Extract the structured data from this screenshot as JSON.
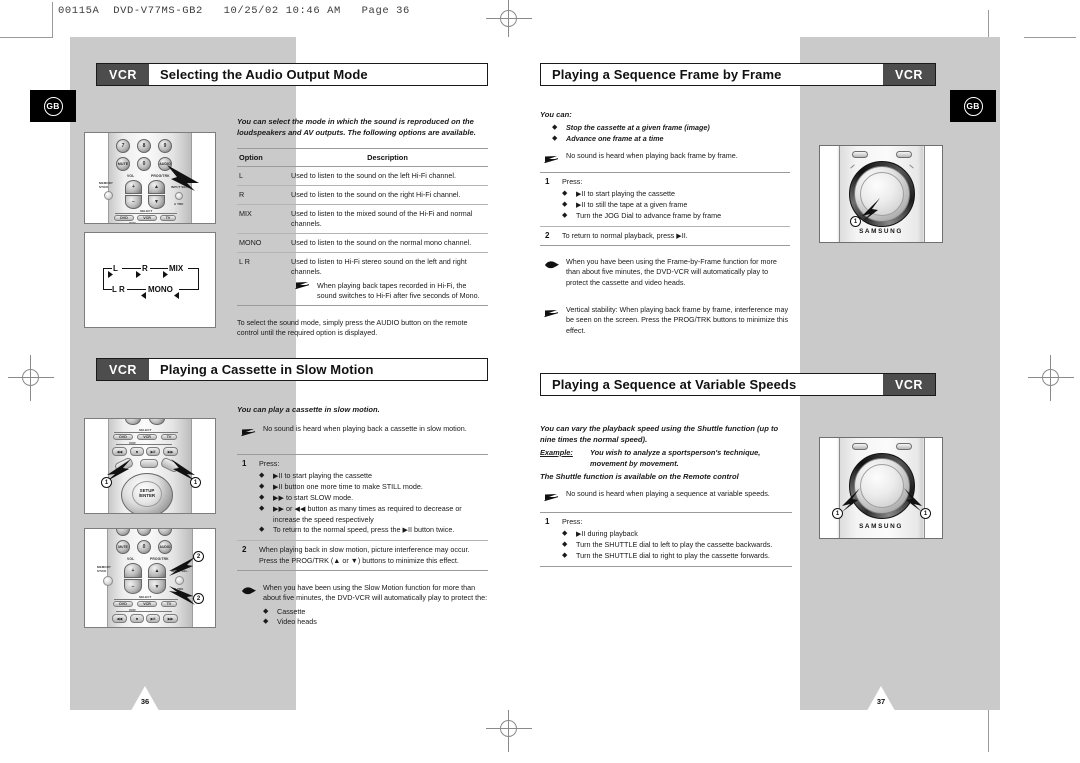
{
  "print_slug": "00115A  DVD-V77MS-GB2   10/25/02 10:46 AM   Page 36",
  "locale_badge": "GB",
  "left_page": {
    "page_number": "36",
    "sections": [
      {
        "badge": "VCR",
        "title": "Selecting the Audio Output Mode",
        "intro": "You can select the mode in which the sound is reproduced on the loudspeakers and AV outputs. The following options are available.",
        "table": {
          "headers": [
            "Option",
            "Description"
          ],
          "rows": [
            {
              "option": "L",
              "description": "Used to listen to the sound on the left Hi-Fi channel.",
              "note": ""
            },
            {
              "option": "R",
              "description": "Used to listen to the sound on the right Hi-Fi channel.",
              "note": ""
            },
            {
              "option": "MIX",
              "description": "Used to listen to the mixed sound of the Hi-Fi and normal channels.",
              "note": ""
            },
            {
              "option": "MONO",
              "description": "Used to listen to the sound on the normal mono channel.",
              "note": ""
            },
            {
              "option": "L R",
              "description": "Used to listen to Hi-Fi stereo sound on the left and right channels.",
              "note": "When playing back tapes recorded in Hi-Fi, the sound switches to Hi-Fi after five seconds of Mono."
            }
          ]
        },
        "footer_note": "To select the sound mode, simply press the AUDIO button on the remote control until the required option is displayed.",
        "loop_diagram": {
          "labels": [
            "L",
            "R",
            "MIX",
            "MONO",
            "L R"
          ]
        }
      },
      {
        "badge": "VCR",
        "title": "Playing a Cassette in Slow Motion",
        "intro": "You can play a cassette in slow motion.",
        "arrow_note": "No sound is heard when playing back a cassette in slow motion.",
        "steps": [
          {
            "number": "1",
            "text": "Press:",
            "bullets": [
              "▶II to start playing the cassette",
              "▶II button one more time to make STILL mode.",
              "▶▶ to start SLOW mode.",
              "▶▶ or ◀◀ button as many times as required to decrease or increase the speed respectively",
              "To return to the normal speed, press the ▶II button twice."
            ]
          },
          {
            "number": "2",
            "text": "When playing back in slow motion, picture interference may occur. Press the PROG/TRK (▲ or ▼) buttons to minimize this effect.",
            "bullets": []
          }
        ],
        "hand_note": "When you have been using the Slow Motion function for more than about five minutes, the DVD-VCR will automatically play to protect the:",
        "hand_note_bullets": [
          "Cassette",
          "Video heads"
        ]
      }
    ]
  },
  "right_page": {
    "page_number": "37",
    "sections": [
      {
        "badge": "VCR",
        "title": "Playing a Sequence Frame by Frame",
        "intro": "You can:",
        "intro_bullets": [
          "Stop the cassette at a given frame (image)",
          "Advance one frame at a time"
        ],
        "arrow_note": "No sound is heard when playing back frame by frame.",
        "steps": [
          {
            "number": "1",
            "text": "Press:",
            "bullets": [
              "▶II to start playing the cassette",
              "▶II to still the tape at a given frame",
              "Turn the JOG Dial to advance frame by frame"
            ]
          },
          {
            "number": "2",
            "text": "To return to normal playback, press ▶II.",
            "bullets": []
          }
        ],
        "hand_note": "When you have been using the Frame-by-Frame function for more than about five minutes, the DVD-VCR will automatically play to protect the cassette and video heads.",
        "arrow_note2": "Vertical stability: When playing back frame by frame, interference may be seen on the screen. Press the PROG/TRK buttons to minimize this effect.",
        "dial_brand": "SAMSUNG",
        "dial_callouts": [
          "1"
        ]
      },
      {
        "badge": "VCR",
        "title": "Playing a Sequence at Variable Speeds",
        "intro": "You can vary the playback speed using the Shuttle function (up to nine times the normal speed).",
        "example_label": "Example:",
        "example_text": "You wish to analyze a sportsperson's technique, movement by movement.",
        "availability": "The Shuttle function is available on the Remote control",
        "arrow_note": "No sound is heard when playing a sequence at variable speeds.",
        "steps": [
          {
            "number": "1",
            "text": "Press:",
            "bullets": [
              "▶II during playback",
              "Turn the SHUTTLE dial to left to play the cassette backwards.",
              "Turn the SHUTTLE dial to right to play the cassette forwards."
            ]
          }
        ],
        "dial_brand": "SAMSUNG",
        "dial_callouts": [
          "1",
          "1"
        ]
      }
    ]
  },
  "remote_illustrations": [
    {
      "name": "audio-button-remote",
      "labels": [
        "7",
        "8",
        "9",
        "VOL",
        "0",
        "AUDIO",
        "VOL",
        "PROG/TRK",
        "MEMORY STICK",
        "INPUT SEL.",
        "A TRK",
        "SELECT",
        "DVD",
        "VCR",
        "TV",
        "VCR"
      ],
      "callouts": []
    },
    {
      "name": "slow-motion-remote-top",
      "labels": [
        "SELECT",
        "DVD",
        "VCR",
        "TV",
        "VCR",
        "SETUP/ENTER"
      ],
      "callouts": [
        "1",
        "1"
      ]
    },
    {
      "name": "slow-motion-remote-bottom",
      "labels": [
        "MUTE",
        "0",
        "AUDIO",
        "VOL",
        "PROG/TRK",
        "MEMORY STICK",
        "INPUT SEL.",
        "A TRK",
        "SELECT",
        "VCR"
      ],
      "callouts": [
        "2",
        "2"
      ]
    }
  ],
  "colors": {
    "page_bg": "#cacaca",
    "badge_bg": "#4d4d4d",
    "card_bg": "#ffffff",
    "rule": "#9b9b9b",
    "text": "#1a1a1a"
  }
}
